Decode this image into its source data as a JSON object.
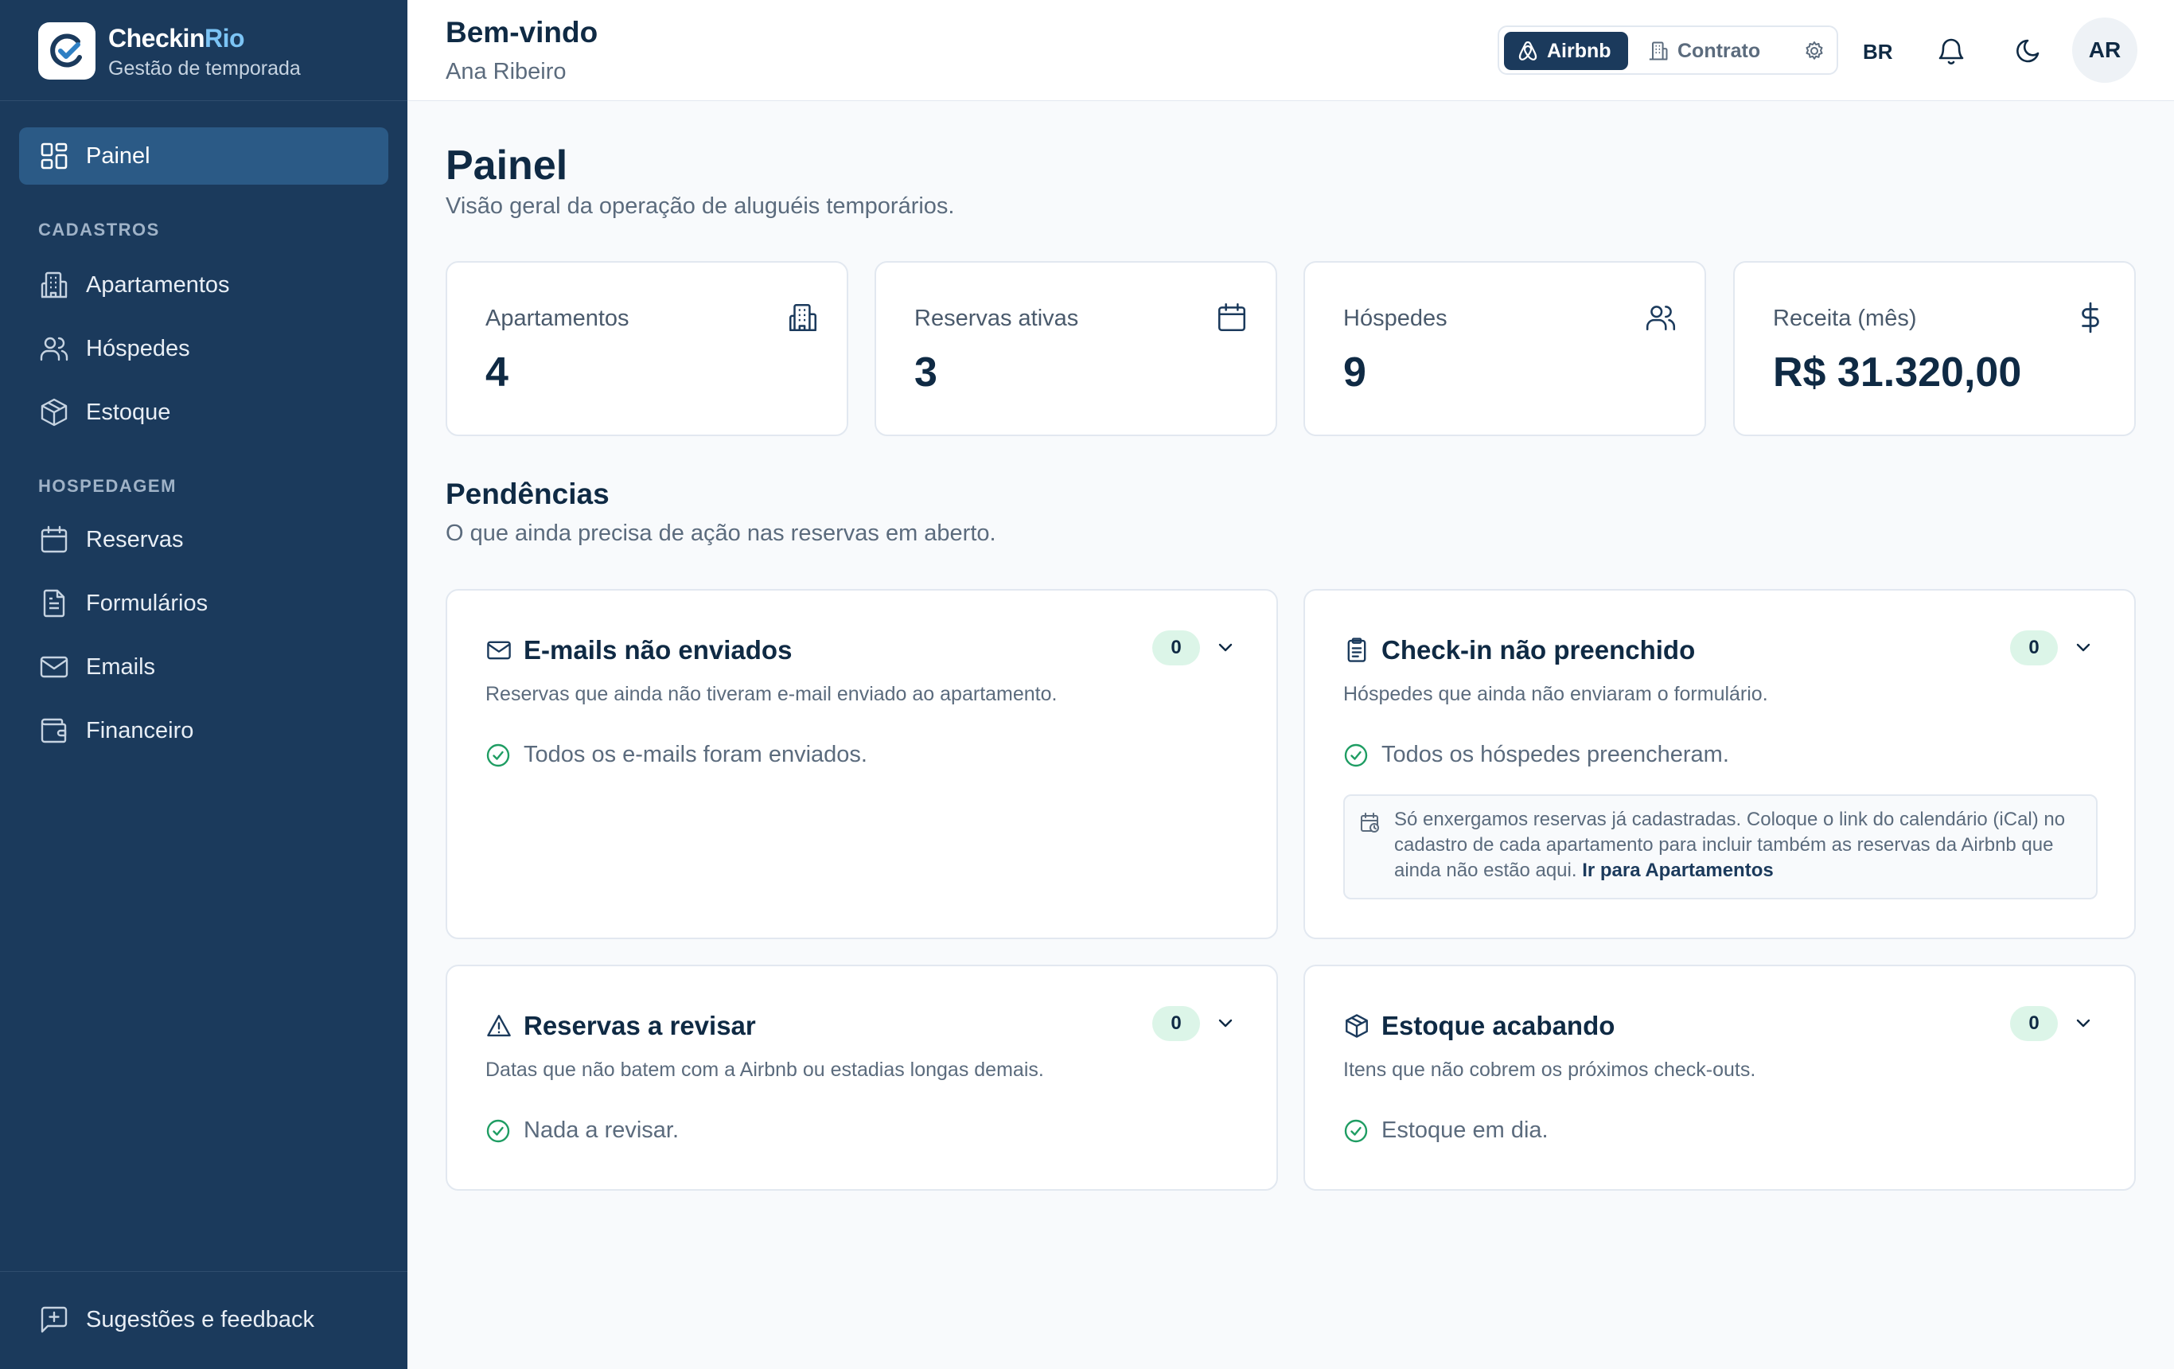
{
  "brand": {
    "name_main": "Checkin",
    "name_accent": "Rio",
    "subtitle": "Gestão de temporada"
  },
  "sidebar": {
    "items": [
      {
        "label": "Painel",
        "icon": "dashboard-icon",
        "active": true
      },
      {
        "label": "Apartamentos",
        "icon": "building-icon"
      },
      {
        "label": "Hóspedes",
        "icon": "users-icon"
      },
      {
        "label": "Estoque",
        "icon": "package-icon"
      },
      {
        "label": "Reservas",
        "icon": "calendar-icon"
      },
      {
        "label": "Formulários",
        "icon": "document-icon"
      },
      {
        "label": "Emails",
        "icon": "mail-icon"
      },
      {
        "label": "Financeiro",
        "icon": "wallet-icon"
      }
    ],
    "sections": {
      "cadastros": "CADASTROS",
      "hospedagem": "HOSPEDAGEM"
    },
    "feedback_label": "Sugestões e feedback"
  },
  "header": {
    "greeting": "Bem-vindo",
    "user_name": "Ana Ribeiro",
    "mode_toggle": {
      "airbnb": "Airbnb",
      "contrato": "Contrato",
      "selected": "Airbnb"
    },
    "language": "BR",
    "avatar_initials": "AR"
  },
  "main": {
    "title": "Painel",
    "subtitle": "Visão geral da operação de aluguéis temporários.",
    "stats": [
      {
        "label": "Apartamentos",
        "value": "4",
        "icon": "building-icon"
      },
      {
        "label": "Reservas ativas",
        "value": "3",
        "icon": "calendar-icon"
      },
      {
        "label": "Hóspedes",
        "value": "9",
        "icon": "users-icon"
      },
      {
        "label": "Receita (mês)",
        "value": "R$ 31.320,00",
        "icon": "dollar-icon"
      }
    ],
    "pending": {
      "title": "Pendências",
      "subtitle": "O que ainda precisa de ação nas reservas em aberto.",
      "cards": [
        {
          "title": "E-mails não enviados",
          "description": "Reservas que ainda não tiveram e-mail enviado ao apartamento.",
          "count": "0",
          "status": "Todos os e-mails foram enviados.",
          "icon": "mail-icon"
        },
        {
          "title": "Check-in não preenchido",
          "description": "Hóspedes que ainda não enviaram o formulário.",
          "count": "0",
          "status": "Todos os hóspedes preencheram.",
          "icon": "clipboard-icon",
          "info": {
            "text": "Só enxergamos reservas já cadastradas. Coloque o link do calendário (iCal) no cadastro de cada apartamento para incluir também as reservas da Airbnb que ainda não estão aqui.",
            "link": "Ir para Apartamentos"
          }
        },
        {
          "title": "Reservas a revisar",
          "description": "Datas que não batem com a Airbnb ou estadias longas demais.",
          "count": "0",
          "status": "Nada a revisar.",
          "icon": "warning-icon"
        },
        {
          "title": "Estoque acabando",
          "description": "Itens que não cobrem os próximos check-outs.",
          "count": "0",
          "status": "Estoque em dia.",
          "icon": "package-icon"
        }
      ]
    }
  },
  "colors": {
    "sidebar_bg": "#1b3a5c",
    "active_item": "#2b5a86",
    "brand_accent": "#7cc4f5",
    "success": "#1f9d63",
    "badge_bg": "#dcf5e8"
  }
}
